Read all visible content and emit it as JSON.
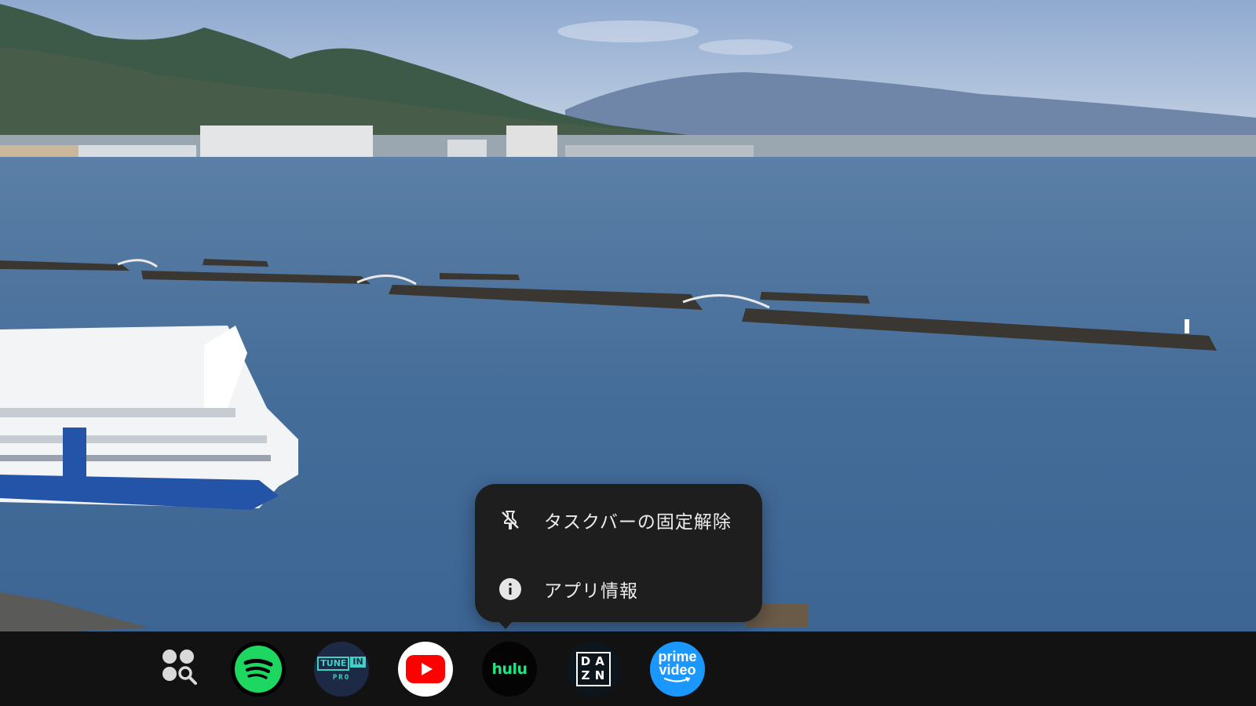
{
  "context_menu": {
    "items": [
      {
        "label": "タスクバーの固定解除",
        "icon": "unpin-icon"
      },
      {
        "label": "アプリ情報",
        "icon": "info-icon"
      }
    ]
  },
  "taskbar": {
    "all_apps_icon": "all-apps-search-icon",
    "apps": [
      {
        "name": "Spotify",
        "icon": "spotify-icon",
        "color": "#1ed760"
      },
      {
        "name": "TuneIn Pro",
        "icon": "tunein-icon",
        "tune": "TUNE",
        "in": "IN",
        "pro": "PRO",
        "color": "#1c2a45"
      },
      {
        "name": "YouTube",
        "icon": "youtube-icon",
        "color": "#ff0000"
      },
      {
        "name": "Hulu",
        "icon": "hulu-icon",
        "text": "hulu",
        "color": "#1ce783"
      },
      {
        "name": "DAZN",
        "icon": "dazn-icon",
        "letters": [
          "D",
          "A",
          "Z",
          "N"
        ],
        "color": "#0c161c"
      },
      {
        "name": "Prime Video",
        "icon": "prime-video-icon",
        "line1": "prime",
        "line2": "video",
        "color": "#1a98ff"
      }
    ]
  }
}
